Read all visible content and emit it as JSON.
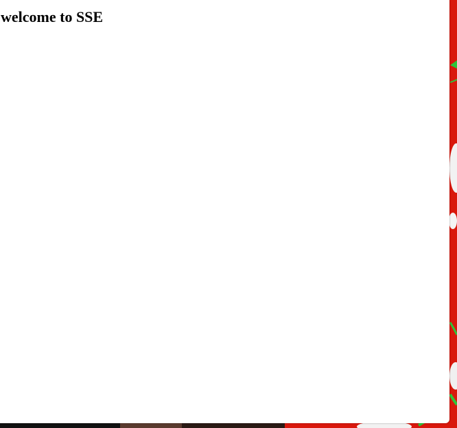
{
  "page": {
    "heading": "welcome to SSE"
  },
  "colors": {
    "page_background": "#ffffff",
    "wallpaper_red": "#d9180c",
    "wallpaper_green": "#2ec43a",
    "text": "#000000"
  },
  "icons": {
    "wallpaper": "desktop-wallpaper"
  }
}
